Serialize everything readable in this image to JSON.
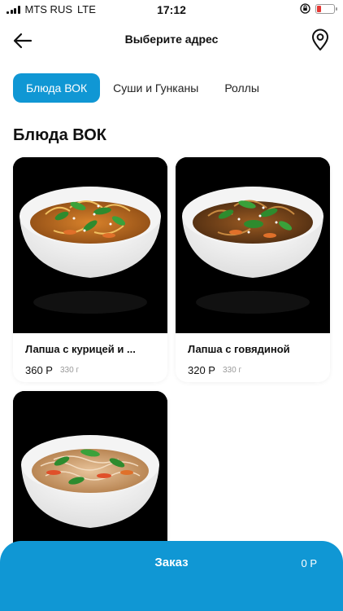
{
  "status_bar": {
    "carrier": "MTS RUS",
    "network": "LTE",
    "time": "17:12"
  },
  "header": {
    "title": "Выберите адрес",
    "back_icon": "arrow-left-icon",
    "location_icon": "map-pin-icon"
  },
  "tabs": [
    {
      "label": "Блюда ВОК",
      "active": true
    },
    {
      "label": "Суши и Гунканы",
      "active": false
    },
    {
      "label": "Роллы",
      "active": false
    }
  ],
  "section": {
    "title": "Блюда ВОК"
  },
  "products": [
    {
      "name": "Лапша с курицей и ...",
      "price": "360 Р",
      "weight": "330 г"
    },
    {
      "name": "Лапша с говядиной",
      "price": "320 Р",
      "weight": "330 г"
    },
    {
      "name": "",
      "price": "",
      "weight": ""
    }
  ],
  "order": {
    "label": "Заказ",
    "sum": "0 Р"
  },
  "colors": {
    "accent": "#1097d4",
    "battery_low": "#e53935"
  }
}
